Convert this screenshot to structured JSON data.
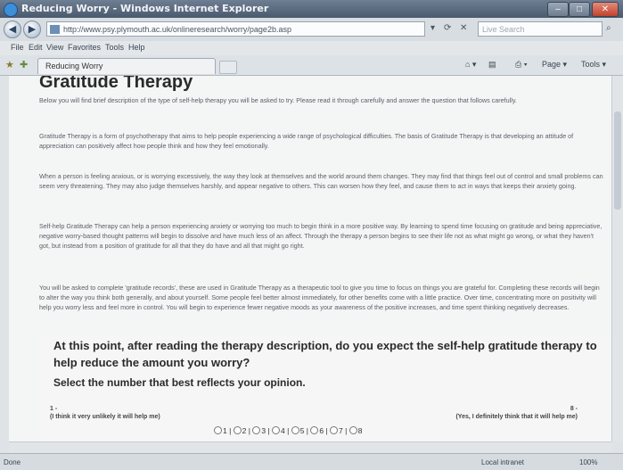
{
  "window": {
    "title": "Reducing Worry - Windows Internet Explorer"
  },
  "address": {
    "url": "http://www.psy.plymouth.ac.uk/onlineresearch/worry/page2b.asp",
    "search_placeholder": "Live Search"
  },
  "menu": [
    "File",
    "Edit",
    "View",
    "Favorites",
    "Tools",
    "Help"
  ],
  "tab": {
    "label": "Reducing Worry"
  },
  "commands": {
    "page": "Page",
    "tools": "Tools"
  },
  "content": {
    "heading": "Gratitude Therapy",
    "paragraphs": [
      "Below you will find brief description of the type of self-help therapy you will be asked to try. Please read it through carefully and answer the question that follows carefully.",
      "Gratitude Therapy is a form of psychotherapy that aims to help people experiencing a wide range of psychological difficulties. The basis of Gratitude Therapy is that developing an attitude of appreciation can positively affect how people think and how they feel emotionally.",
      "When a person is feeling anxious, or is worrying excessively, the way they look at themselves and the world around them changes. They may find that things feel out of control and small problems can seem very threatening. They may also judge themselves harshly, and appear negative to others. This can worsen how they feel, and cause them to act in ways that keeps their anxiety going.",
      "Self-help Gratitude Therapy can help a person experiencing anxiety or worrying too much to begin think in a more positive way. By learning to spend time focusing on gratitude and being appreciative, negative worry-based thought patterns will begin to dissolve and have much less of an affect. Through the therapy a person begins to see their life not as what might go wrong, or what they haven't got, but instead from a position of gratitude for all that they do have and all that might go right.",
      "You will be asked to complete 'gratitude records', these are used in Gratitude Therapy as a therapeutic tool to give you time to focus on things you are grateful for. Completing these records will begin to alter the way you think both generally, and about yourself. Some people feel better almost immediately, for other benefits come with a little practice. Over time, concentrating more on positivity will help you worry less and feel more in control. You will begin to experience fewer negative moods as your awareness of the positive increases, and time spent thinking negatively decreases."
    ],
    "question": "At this point, after reading the therapy description, do you expect the self-help gratitude therapy to help reduce the amount you worry?",
    "instruction": "Select the number that best reflects your opinion.",
    "scale_left_num": "1 -",
    "scale_left_text": "(I think it very unlikely it will help me)",
    "scale_right_num": "8 -",
    "scale_right_text": "(Yes, I definitely think that it will help me)",
    "options": [
      "1",
      "2",
      "3",
      "4",
      "5",
      "6",
      "7",
      "8"
    ]
  },
  "status": {
    "left": "Done",
    "zone": "Local intranet",
    "zoom": "100%"
  }
}
